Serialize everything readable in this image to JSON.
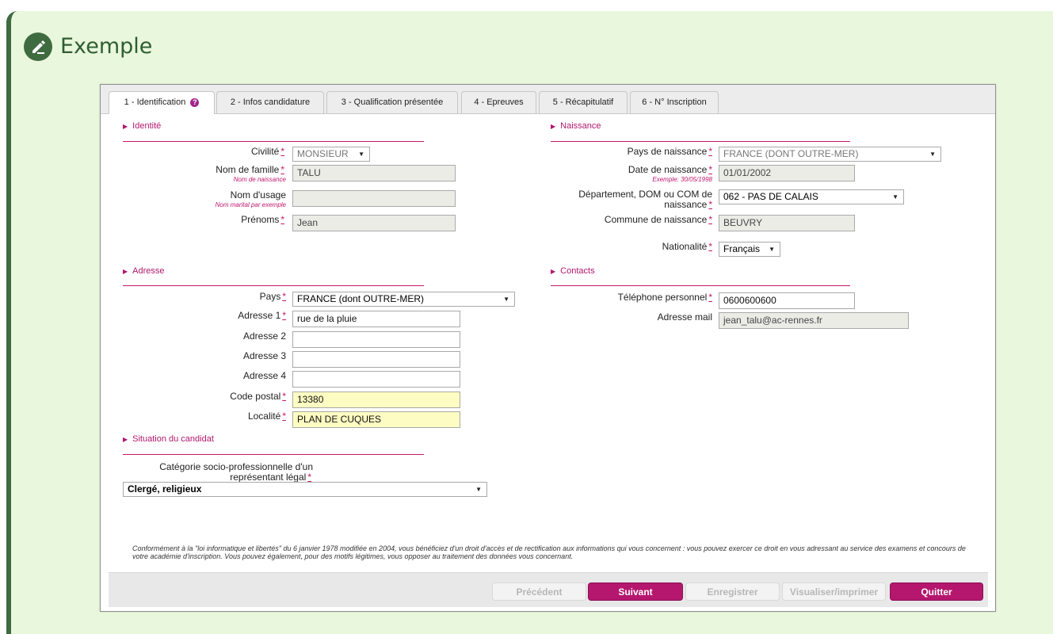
{
  "banner": {
    "title": "Exemple",
    "icon": "pencil-icon"
  },
  "tabs": [
    {
      "label": "1 - Identification",
      "help": "?"
    },
    {
      "label": "2 - Infos candidature"
    },
    {
      "label": "3 - Qualification présentée"
    },
    {
      "label": "4 - Epreuves"
    },
    {
      "label": "5 - Récapitulatif"
    },
    {
      "label": "6 - N° Inscription"
    }
  ],
  "required_mark": "*",
  "identite": {
    "title": "Identité",
    "civilite": {
      "label": "Civilité",
      "value": "MONSIEUR"
    },
    "nom_famille": {
      "label": "Nom de famille",
      "hint": "Nom de naissance",
      "value": "TALU"
    },
    "nom_usage": {
      "label": "Nom d'usage",
      "hint": "Nom marital par exemple",
      "value": ""
    },
    "prenoms": {
      "label": "Prénoms",
      "value": "Jean"
    }
  },
  "naissance": {
    "title": "Naissance",
    "pays": {
      "label": "Pays de naissance",
      "value": "FRANCE (DONT OUTRE-MER)"
    },
    "date": {
      "label": "Date de naissance",
      "hint": "Exemple: 30/05/1998",
      "value": "01/01/2002"
    },
    "departement": {
      "label_line1": "Département, DOM ou COM de",
      "label_line2": "naissance",
      "value": "062 - PAS DE CALAIS"
    },
    "commune": {
      "label": "Commune de naissance",
      "value": "BEUVRY"
    },
    "nationalite": {
      "label": "Nationalité",
      "value": "Français"
    }
  },
  "adresse": {
    "title": "Adresse",
    "pays": {
      "label": "Pays",
      "value": "FRANCE (dont OUTRE-MER)"
    },
    "adresse1": {
      "label": "Adresse 1",
      "value": "rue de la pluie"
    },
    "adresse2": {
      "label": "Adresse 2",
      "value": ""
    },
    "adresse3": {
      "label": "Adresse 3",
      "value": ""
    },
    "adresse4": {
      "label": "Adresse 4",
      "value": ""
    },
    "code_postal": {
      "label": "Code postal",
      "value": "13380"
    },
    "localite": {
      "label": "Localité",
      "value": "PLAN DE CUQUES"
    }
  },
  "contacts": {
    "title": "Contacts",
    "telephone": {
      "label": "Téléphone personnel",
      "value": "0600600600"
    },
    "mail": {
      "label": "Adresse mail",
      "value": "jean_talu@ac-rennes.fr"
    }
  },
  "situation": {
    "title": "Situation du candidat",
    "categorie": {
      "label_line1": "Catégorie socio-professionnelle d'un",
      "label_line2": "représentant légal",
      "value": "Clergé, religieux"
    }
  },
  "legal_text": "Conformément à la \"loi informatique et libertés\" du 6 janvier 1978 modifiée en 2004, vous bénéficiez d'un droit d'accès et de rectification aux informations qui vous concernent : vous pouvez exercer ce droit en vous adressant au service des examens et concours de votre académie d'inscription. Vous pouvez également, pour des motifs légitimes, vous opposer au traitement des données vous concernant.",
  "buttons": {
    "precedent": "Précédent",
    "suivant": "Suivant",
    "enregistrer": "Enregistrer",
    "visualiser": "Visualiser/imprimer",
    "quitter": "Quitter"
  },
  "colors": {
    "accent": "#b5176e",
    "banner_bg": "#e9f7dc",
    "banner_dark": "#3f6b40"
  }
}
